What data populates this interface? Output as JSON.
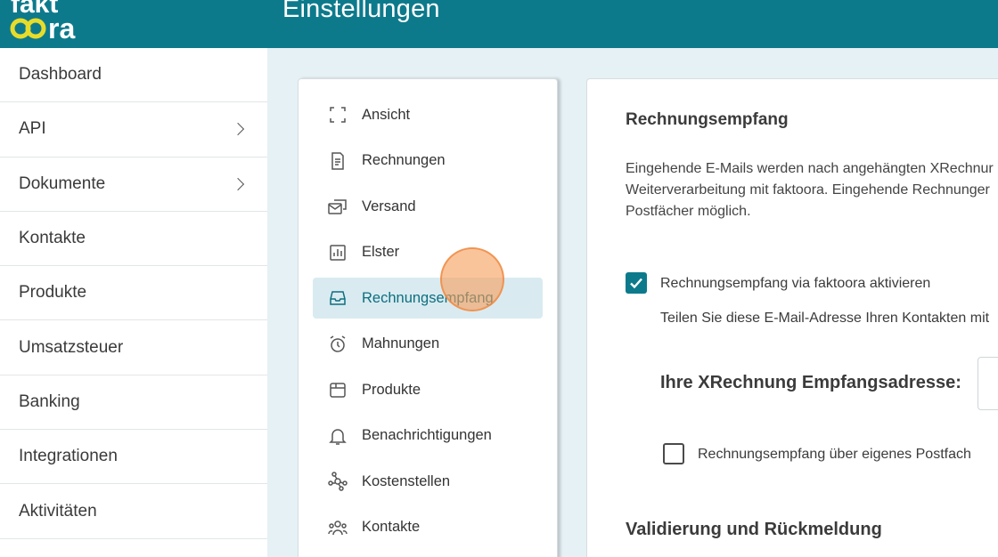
{
  "app": {
    "logo_text_top": "fakt",
    "logo_text_bottom": "oora",
    "page_title": "Einstellungen",
    "brand_color": "#0d7a8c",
    "logo_accent_color": "#e8dc2a"
  },
  "sidebar": {
    "items": [
      {
        "label": "Dashboard",
        "has_chevron": false
      },
      {
        "label": "API",
        "has_chevron": true
      },
      {
        "label": "Dokumente",
        "has_chevron": true
      },
      {
        "label": "Kontakte",
        "has_chevron": false
      },
      {
        "label": "Produkte",
        "has_chevron": false
      },
      {
        "label": "Umsatzsteuer",
        "has_chevron": false
      },
      {
        "label": "Banking",
        "has_chevron": false
      },
      {
        "label": "Integrationen",
        "has_chevron": false
      },
      {
        "label": "Aktivitäten",
        "has_chevron": false
      }
    ]
  },
  "settings_menu": {
    "active_index": 4,
    "items": [
      {
        "label": "Ansicht",
        "icon": "fullscreen-icon"
      },
      {
        "label": "Rechnungen",
        "icon": "invoice-icon"
      },
      {
        "label": "Versand",
        "icon": "send-mail-icon"
      },
      {
        "label": "Elster",
        "icon": "chart-icon"
      },
      {
        "label": "Rechnungsempfang",
        "icon": "inbox-icon"
      },
      {
        "label": "Mahnungen",
        "icon": "alarm-icon"
      },
      {
        "label": "Produkte",
        "icon": "box-icon"
      },
      {
        "label": "Benachrichtigungen",
        "icon": "bell-icon"
      },
      {
        "label": "Kostenstellen",
        "icon": "network-icon"
      },
      {
        "label": "Kontakte",
        "icon": "people-icon"
      }
    ]
  },
  "content": {
    "title": "Rechnungsempfang",
    "description": [
      "Eingehende E-Mails werden nach angehängten XRechnur",
      "Weiterverarbeitung mit faktoora. Eingehende Rechnunger",
      "Postfächer möglich."
    ],
    "enable_checkbox": {
      "checked": true,
      "label": "Rechnungsempfang via faktoora aktivieren"
    },
    "share_hint": "Teilen Sie diese E-Mail-Adresse Ihren Kontakten mit",
    "address_label": "Ihre XRechnung Empfangsadresse:",
    "own_mailbox_checkbox": {
      "checked": false,
      "label": "Rechnungsempfang über eigenes Postfach"
    },
    "section2_title": "Validierung und Rückmeldung"
  }
}
